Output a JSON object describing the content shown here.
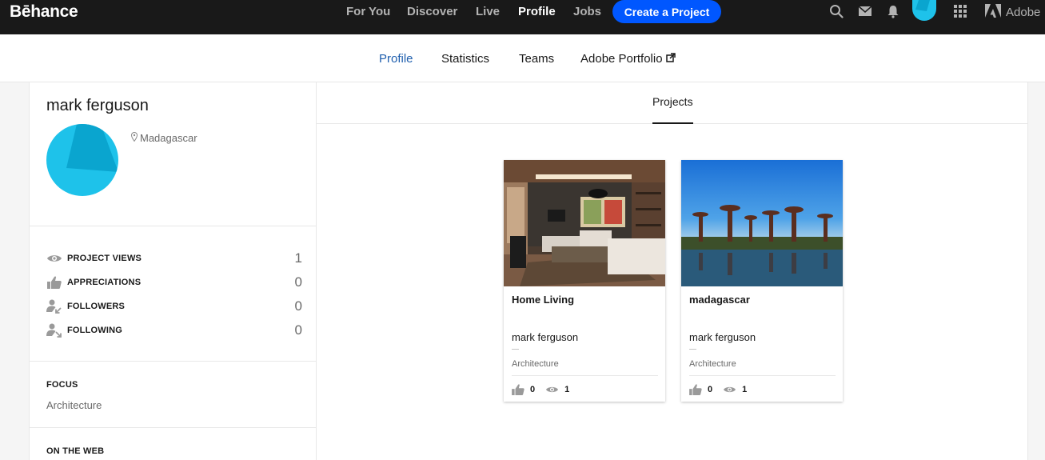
{
  "topbar": {
    "logo": "Bēhance",
    "nav": [
      "For You",
      "Discover",
      "Live",
      "Profile",
      "Jobs"
    ],
    "active_nav": "Profile",
    "create_label": "Create a Project",
    "adobe_label": "Adobe",
    "icons": [
      "search-icon",
      "mail-icon",
      "bell-icon",
      "avatar",
      "apps-grid-icon",
      "adobe-logo-icon"
    ],
    "accent": "#0057ff"
  },
  "subnav": {
    "items": [
      "Profile",
      "Statistics",
      "Teams",
      "Adobe Portfolio"
    ],
    "active": "Profile"
  },
  "profile": {
    "name": "mark ferguson",
    "location": "Madagascar",
    "stats": [
      {
        "label": "PROJECT VIEWS",
        "value": "1",
        "icon": "eye-icon"
      },
      {
        "label": "APPRECIATIONS",
        "value": "0",
        "icon": "thumbs-up-icon"
      },
      {
        "label": "FOLLOWERS",
        "value": "0",
        "icon": "followers-icon"
      },
      {
        "label": "FOLLOWING",
        "value": "0",
        "icon": "following-icon"
      }
    ],
    "focus_title": "FOCUS",
    "focus_value": "Architecture",
    "web_title": "ON THE WEB",
    "avatar_color": "#1ec2ea"
  },
  "main": {
    "tab": "Projects",
    "projects": [
      {
        "title": "Home Living",
        "owner": "mark ferguson",
        "field": "Architecture",
        "appreciations": "0",
        "views": "1",
        "image": "living-room-photo"
      },
      {
        "title": "madagascar",
        "owner": "mark ferguson",
        "field": "Architecture",
        "appreciations": "0",
        "views": "1",
        "image": "baobab-photo"
      }
    ]
  }
}
